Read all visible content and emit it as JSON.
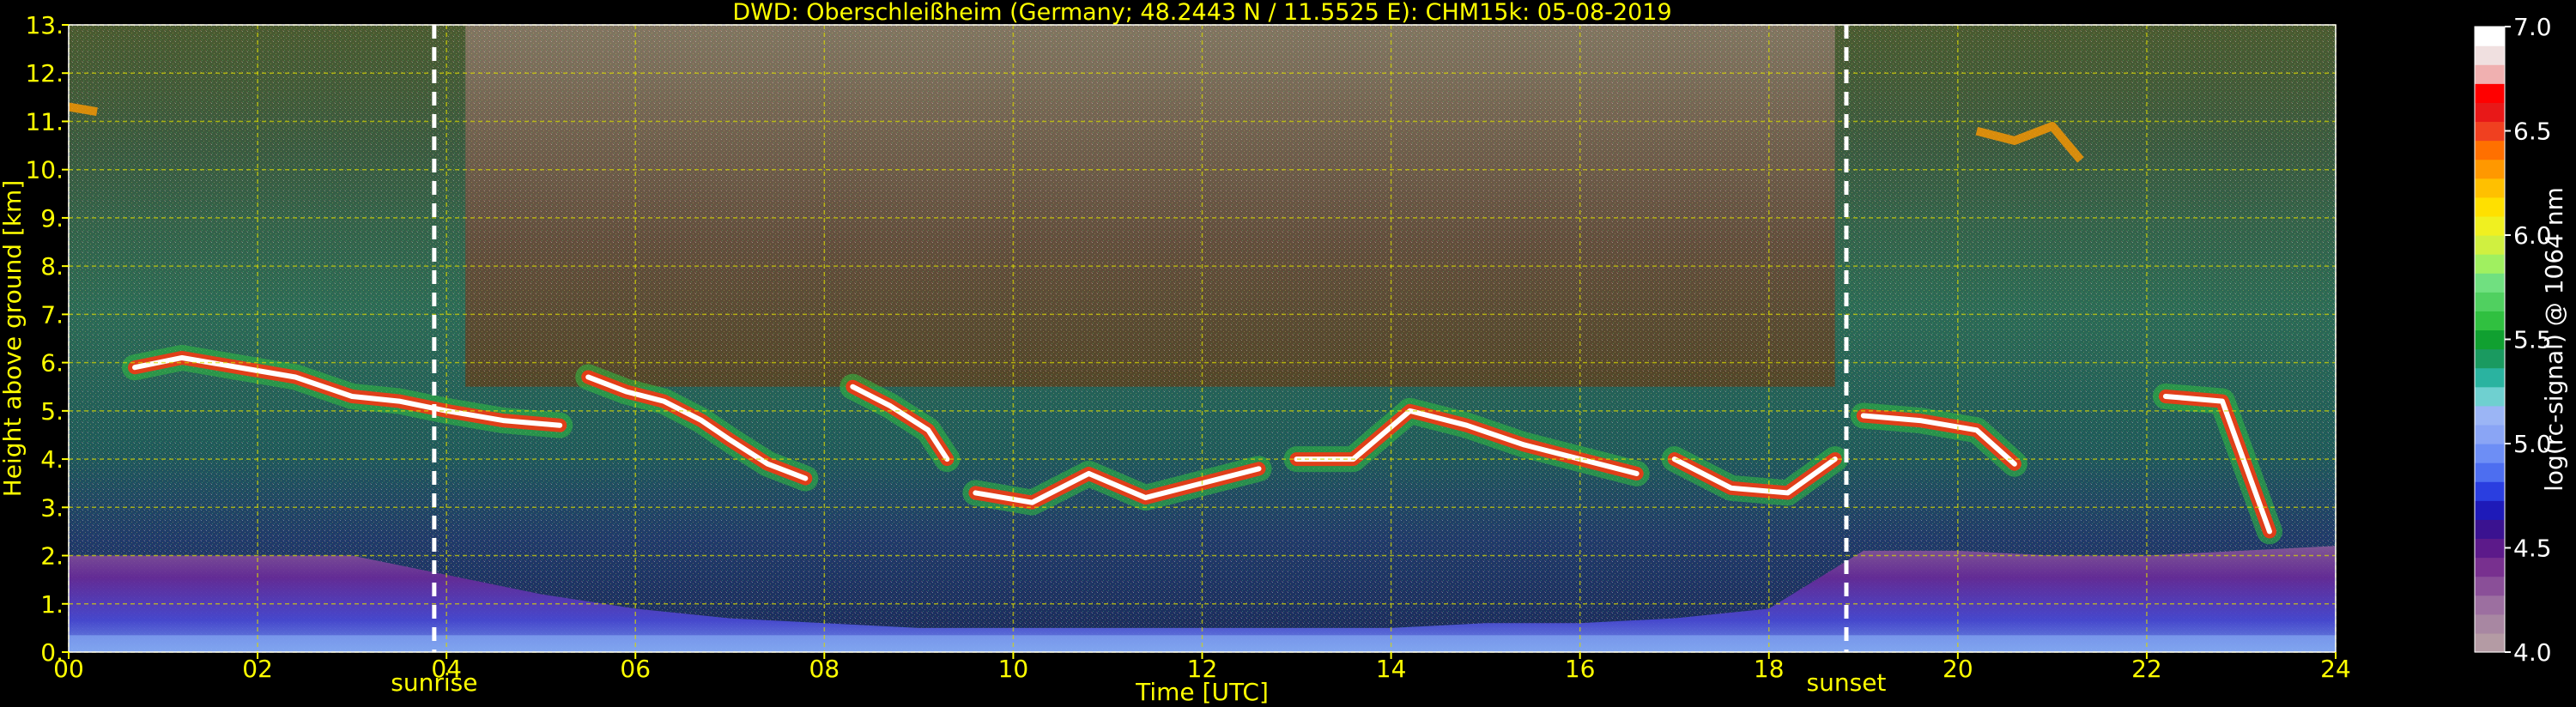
{
  "chart_data": {
    "type": "heatmap",
    "title": "DWD: Oberschleißheim (Germany; 48.2443 N / 11.5525 E):    CHM15k: 05-08-2019",
    "xlabel": "Time [UTC]",
    "ylabel": "Height above ground [km]",
    "xlim": [
      0,
      24
    ],
    "ylim": [
      0,
      13
    ],
    "x_ticks": [
      "00",
      "02",
      "04",
      "06",
      "08",
      "10",
      "12",
      "14",
      "16",
      "18",
      "20",
      "22",
      "24"
    ],
    "y_ticks": [
      "0.",
      "1.",
      "2.",
      "3.",
      "4.",
      "5.",
      "6.",
      "7.",
      "8.",
      "9.",
      "10.",
      "11.",
      "12.",
      "13."
    ],
    "grid": true,
    "markers": [
      {
        "label": "sunrise",
        "x": 3.87
      },
      {
        "label": "sunset",
        "x": 18.82
      }
    ],
    "colorbar": {
      "label": "log(rc-signal) @ 1064 nm",
      "range": [
        4.0,
        7.0
      ],
      "ticks": [
        "4.0",
        "4.5",
        "5.0",
        "5.5",
        "6.0",
        "6.5",
        "7.0"
      ],
      "colors": [
        "#b49ba4",
        "#a887a2",
        "#9c6fa0",
        "#8a4f98",
        "#78308f",
        "#5c1a8a",
        "#3a1290",
        "#1e1ab8",
        "#2a3ee0",
        "#4d6ef0",
        "#6d8ef5",
        "#8aa5f5",
        "#9bb5f5",
        "#6fd0d0",
        "#2ab3a0",
        "#1a9a60",
        "#10a030",
        "#30c040",
        "#50d060",
        "#70e080",
        "#a0f060",
        "#d0f040",
        "#f0f020",
        "#ffe000",
        "#ffc000",
        "#ff9800",
        "#ff7000",
        "#f04020",
        "#e81818",
        "#ff0000",
        "#f0b0b0",
        "#f0e0e0",
        "#ffffff"
      ]
    },
    "features": [
      {
        "type": "boundary_layer",
        "x_start": 0,
        "x_end": 24,
        "top_km": [
          2.0,
          2.0,
          2.0,
          2.0,
          1.6,
          1.2,
          0.9,
          0.7,
          0.6,
          0.5,
          0.5,
          0.5,
          0.5,
          0.5,
          0.5,
          0.6,
          0.6,
          0.7,
          0.9,
          2.1,
          2.1,
          2.0,
          2.0,
          2.1,
          2.2
        ]
      },
      {
        "type": "cloud",
        "x": [
          0.7,
          1.2,
          1.8,
          2.4,
          3.0,
          3.5,
          4.0,
          4.6,
          5.2
        ],
        "y": [
          5.9,
          6.1,
          5.9,
          5.7,
          5.3,
          5.2,
          5.0,
          4.8,
          4.7
        ]
      },
      {
        "type": "cloud",
        "x": [
          5.5,
          5.9,
          6.3,
          6.7,
          7.0,
          7.4,
          7.8
        ],
        "y": [
          5.7,
          5.4,
          5.2,
          4.8,
          4.4,
          3.9,
          3.6
        ]
      },
      {
        "type": "cloud",
        "x": [
          8.3,
          8.7,
          9.1,
          9.3
        ],
        "y": [
          5.5,
          5.1,
          4.6,
          4.0
        ]
      },
      {
        "type": "cloud",
        "x": [
          9.6,
          10.2,
          10.8,
          11.4,
          12.0,
          12.6
        ],
        "y": [
          3.3,
          3.1,
          3.7,
          3.2,
          3.5,
          3.8
        ]
      },
      {
        "type": "cloud",
        "x": [
          13.0,
          13.6,
          14.2,
          14.8,
          15.4,
          16.0,
          16.6
        ],
        "y": [
          4.0,
          4.0,
          5.0,
          4.7,
          4.3,
          4.0,
          3.7
        ]
      },
      {
        "type": "cloud",
        "x": [
          17.0,
          17.6,
          18.2,
          18.7
        ],
        "y": [
          4.0,
          3.4,
          3.3,
          4.0
        ]
      },
      {
        "type": "cloud",
        "x": [
          19.0,
          19.6,
          20.2,
          20.6
        ],
        "y": [
          4.9,
          4.8,
          4.6,
          3.9
        ]
      },
      {
        "type": "cloud",
        "x": [
          22.2,
          22.8,
          23.3
        ],
        "y": [
          5.3,
          5.2,
          2.5
        ]
      },
      {
        "type": "cirrus",
        "x": [
          20.2,
          20.6,
          21.0,
          21.3
        ],
        "y": [
          10.8,
          10.6,
          10.9,
          10.2
        ]
      },
      {
        "type": "cirrus",
        "x": [
          0.0,
          0.3
        ],
        "y": [
          11.3,
          11.2
        ]
      }
    ]
  }
}
